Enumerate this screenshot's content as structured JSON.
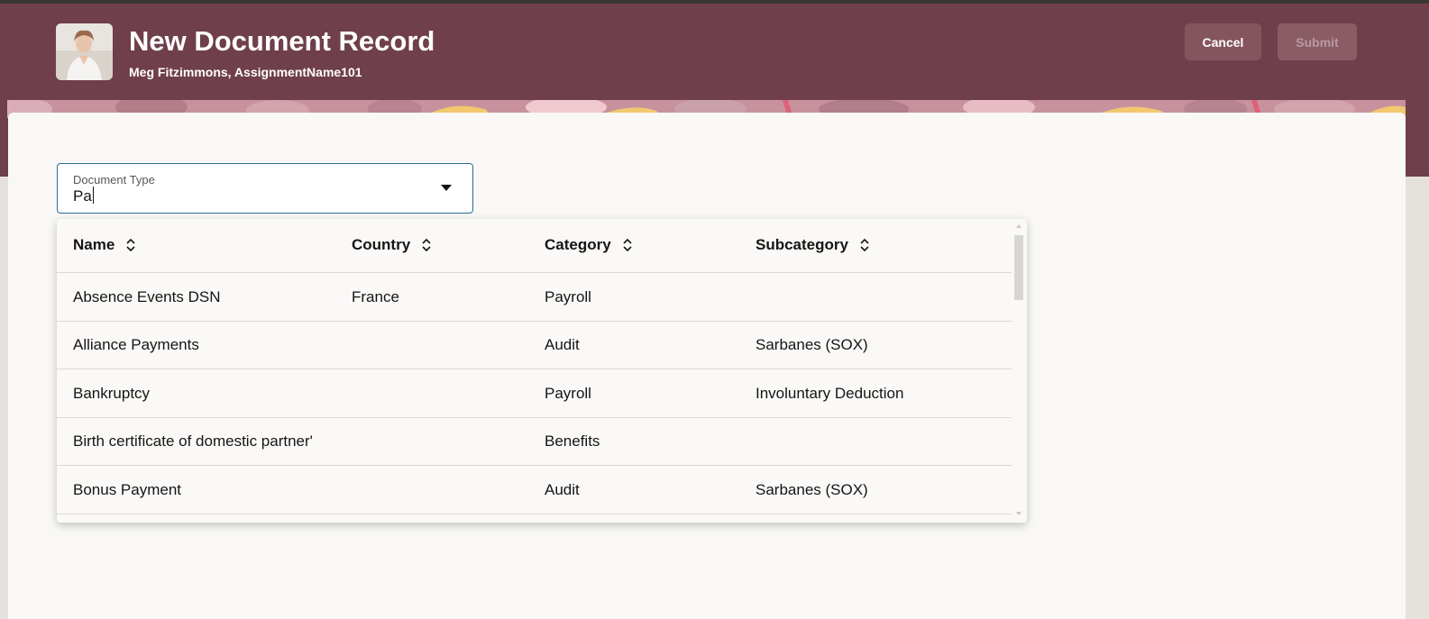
{
  "header": {
    "title": "New Document Record",
    "subtitle": "Meg Fitzimmons, AssignmentName101",
    "cancel_label": "Cancel",
    "submit_label": "Submit"
  },
  "form": {
    "document_type_label": "Document Type",
    "document_type_value": "Pa"
  },
  "table": {
    "headers": [
      "Name",
      "Country",
      "Category",
      "Subcategory"
    ],
    "rows": [
      {
        "name": "Absence Events DSN",
        "country": "France",
        "category": "Payroll",
        "subcategory": ""
      },
      {
        "name": "Alliance Payments",
        "country": "",
        "category": "Audit",
        "subcategory": "Sarbanes (SOX)"
      },
      {
        "name": "Bankruptcy",
        "country": "",
        "category": "Payroll",
        "subcategory": "Involuntary Deduction"
      },
      {
        "name": "Birth certificate of domestic partner'",
        "country": "",
        "category": "Benefits",
        "subcategory": ""
      },
      {
        "name": "Bonus Payment",
        "country": "",
        "category": "Audit",
        "subcategory": "Sarbanes (SOX)"
      }
    ]
  },
  "colors": {
    "header_bg": "#6f3f4b",
    "focus_border": "#2c6d93",
    "card_bg": "#f9f8f6"
  }
}
